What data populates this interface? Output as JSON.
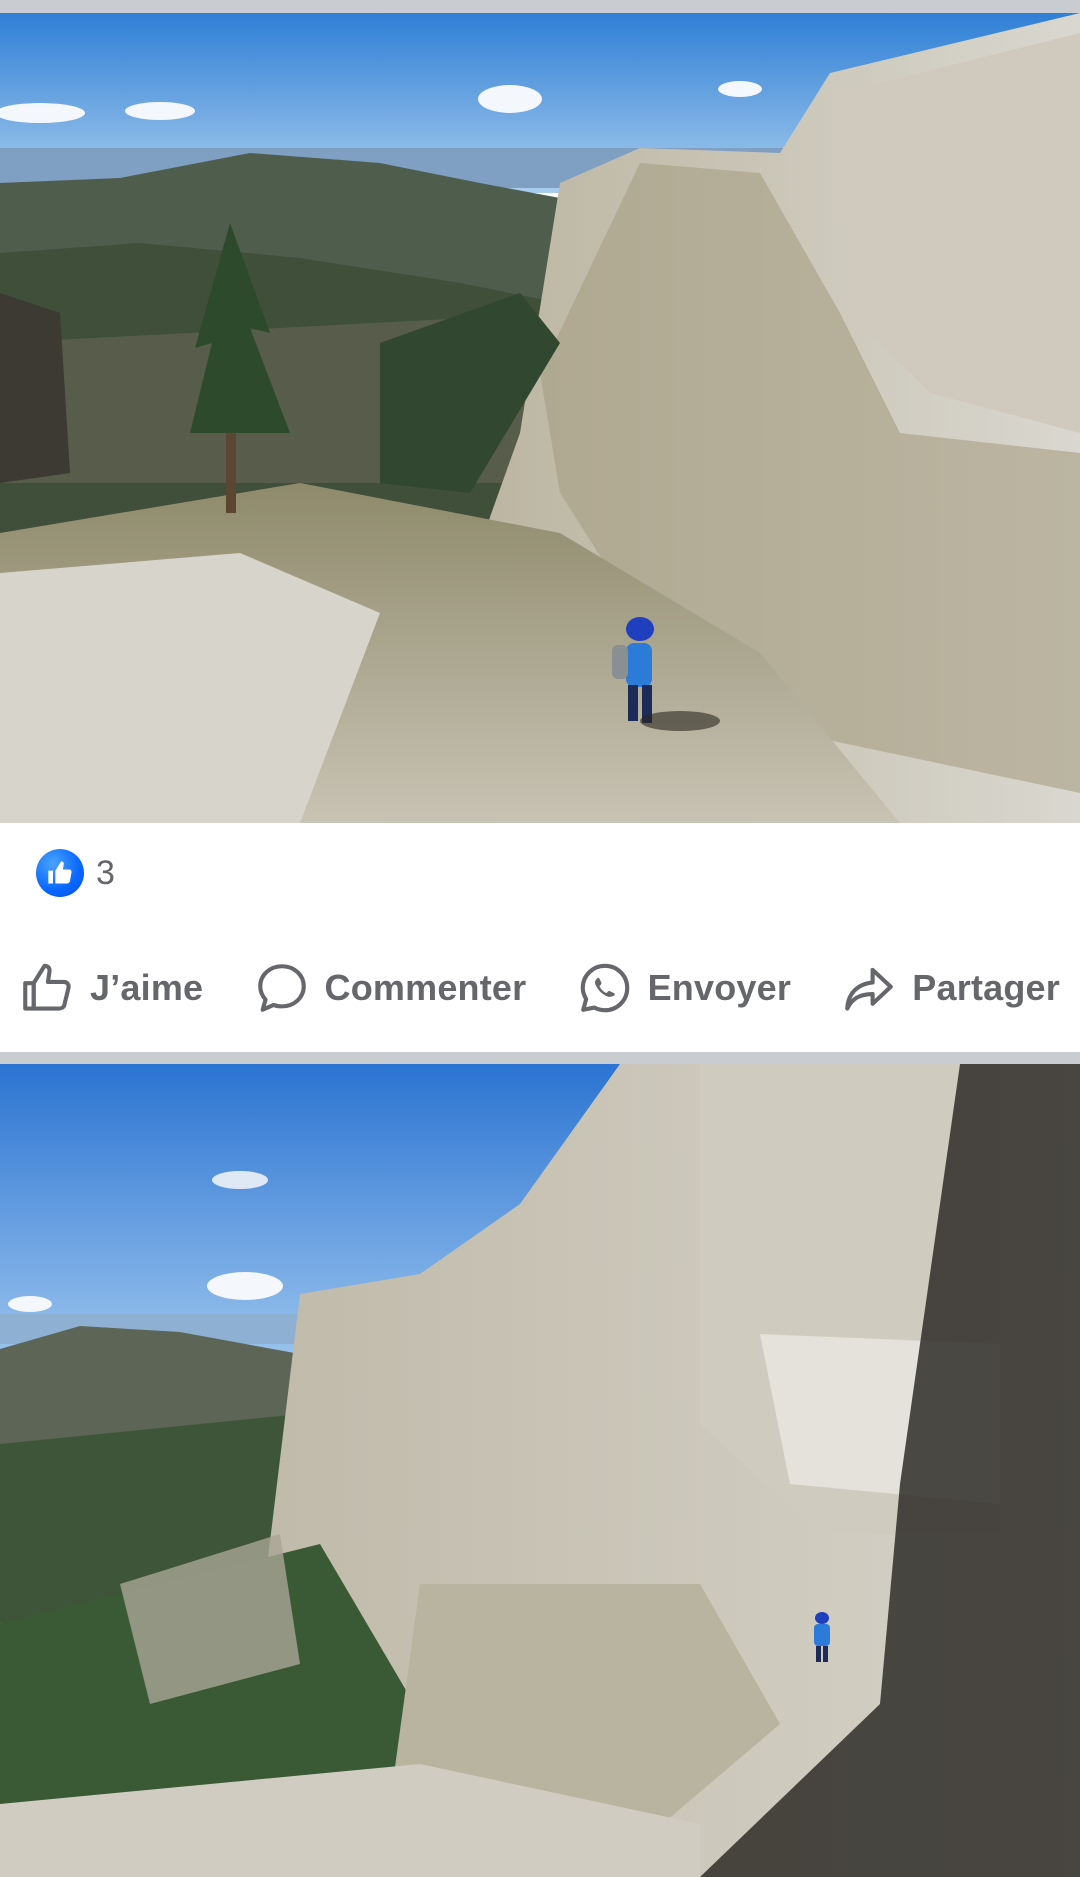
{
  "post": {
    "reaction_count": "3",
    "reaction_icon": "like-icon",
    "actions": [
      {
        "label": "J’aime",
        "icon": "thumbs-up-icon"
      },
      {
        "label": "Commenter",
        "icon": "comment-icon"
      },
      {
        "label": "Envoyer",
        "icon": "whatsapp-icon"
      },
      {
        "label": "Partager",
        "icon": "share-icon"
      }
    ]
  },
  "colors": {
    "accent": "#0866ff",
    "secondary_text": "#65676b",
    "divider": "#c9ccd1"
  }
}
